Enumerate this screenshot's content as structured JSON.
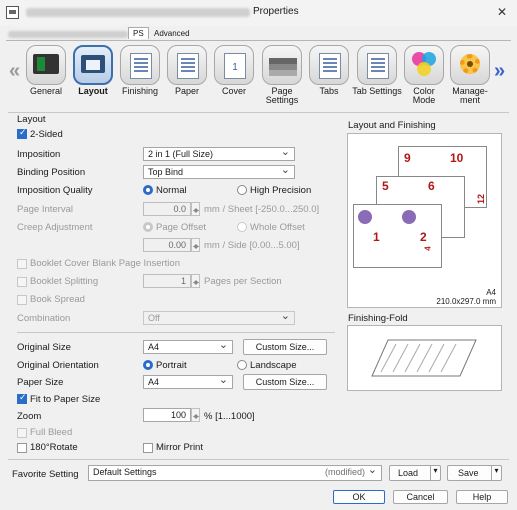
{
  "window": {
    "title": "Properties",
    "close": "✕"
  },
  "tabs": [
    {
      "label": "PS"
    },
    {
      "label": "Advanced"
    }
  ],
  "nav": {
    "items": [
      {
        "label": "General"
      },
      {
        "label": "Layout"
      },
      {
        "label": "Finishing"
      },
      {
        "label": "Paper"
      },
      {
        "label": "Cover"
      },
      {
        "label": "Page Settings"
      },
      {
        "label": "Tabs"
      },
      {
        "label": "Tab Settings"
      },
      {
        "label": "Color\nMode"
      },
      {
        "label": "Manage-\nment"
      }
    ],
    "selected_index": 1
  },
  "layout": {
    "section": "Layout",
    "two_sided": {
      "label": "2-Sided",
      "checked": true
    },
    "imposition": {
      "label": "Imposition",
      "value": "2 in 1 (Full Size)"
    },
    "binding_position": {
      "label": "Binding Position",
      "value": "Top Bind"
    },
    "imposition_quality": {
      "label": "Imposition Quality",
      "options": [
        "Normal",
        "High Precision"
      ],
      "selected": "Normal"
    },
    "page_interval": {
      "label": "Page Interval",
      "value": "0.0",
      "unit": "mm / Sheet [-250.0...250.0]"
    },
    "creep_adjustment": {
      "label": "Creep Adjustment",
      "options": [
        "Page Offset",
        "Whole Offset"
      ],
      "selected": "Page Offset",
      "value": "0.00",
      "unit": "mm / Side [0.00...5.00]"
    },
    "booklet_cover": {
      "label": "Booklet Cover Blank Page Insertion",
      "checked": false
    },
    "booklet_splitting": {
      "label": "Booklet Splitting",
      "value": "1",
      "unit": "Pages per Section",
      "checked": false
    },
    "book_spread": {
      "label": "Book Spread",
      "checked": false
    },
    "combination": {
      "label": "Combination",
      "value": "Off"
    },
    "original_size": {
      "label": "Original Size",
      "value": "A4",
      "button": "Custom Size..."
    },
    "original_orientation": {
      "label": "Original Orientation",
      "options": [
        "Portrait",
        "Landscape"
      ],
      "selected": "Portrait"
    },
    "paper_size": {
      "label": "Paper Size",
      "value": "A4",
      "button": "Custom Size..."
    },
    "fit_to_paper": {
      "label": "Fit to Paper Size",
      "checked": true
    },
    "zoom": {
      "label": "Zoom",
      "value": "100",
      "unit": "% [1...1000]"
    },
    "full_bleed": {
      "label": "Full Bleed",
      "checked": false
    },
    "rotate": {
      "label": "180°Rotate",
      "checked": false
    },
    "mirror": {
      "label": "Mirror Print",
      "checked": false
    }
  },
  "preview": {
    "title": "Layout and Finishing",
    "paper": "A4",
    "dims": "210.0x297.0 mm",
    "page_numbers": [
      "9",
      "10",
      "5",
      "6",
      "1",
      "2",
      "12",
      "4"
    ],
    "fold_title": "Finishing-Fold"
  },
  "favorite": {
    "label": "Favorite Setting",
    "value": "Default Settings",
    "status": "(modified)",
    "load": "Load",
    "save": "Save"
  },
  "footer": {
    "ok": "OK",
    "cancel": "Cancel",
    "help": "Help"
  },
  "colors": {
    "accent": "#2b6cc9",
    "page_number": "#b01818"
  }
}
